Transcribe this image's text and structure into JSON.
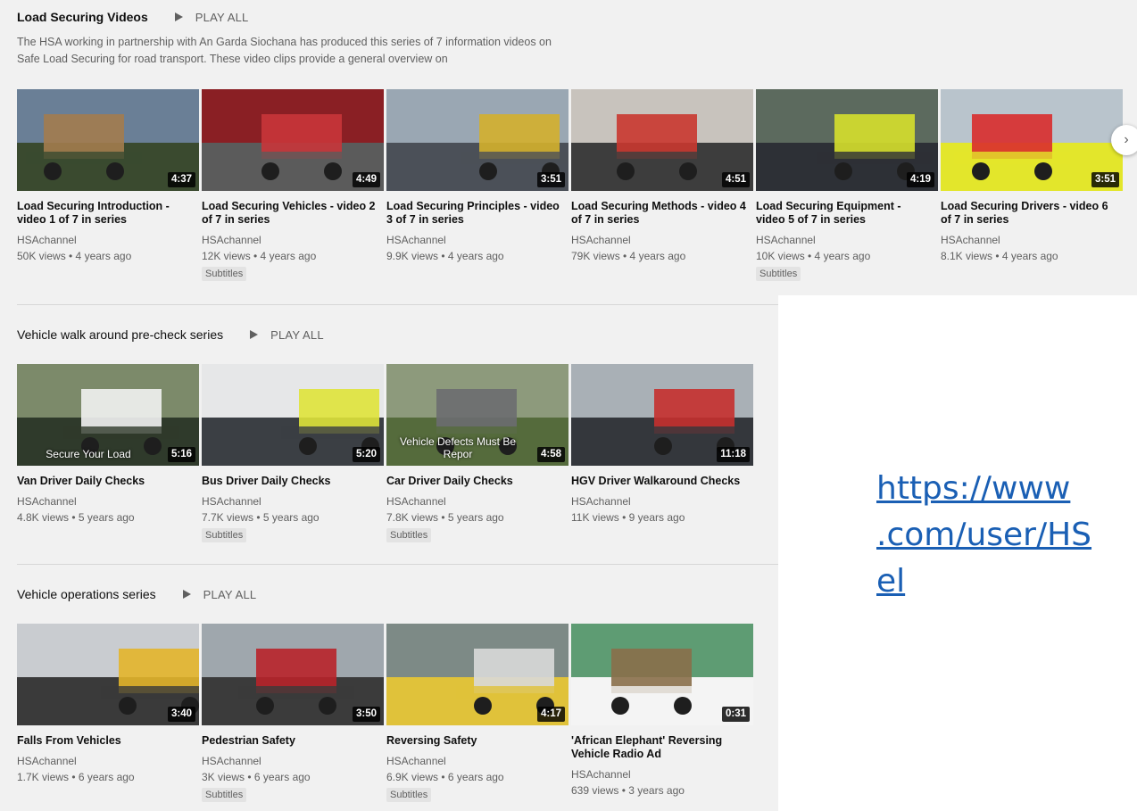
{
  "sections": [
    {
      "title": "Load Securing Videos",
      "play_all": "PLAY ALL",
      "description": "The HSA working in partnership with An Garda Siochana has produced this series of 7 information videos on Safe Load Securing for road transport. These video clips provide a general overview on",
      "videos": [
        {
          "title": "Load Securing Introduction - video 1 of 7 in series",
          "channel": "HSAchannel",
          "meta": "50K views • 4 years ago",
          "duration": "4:37",
          "badge": "",
          "thumb_colors": [
            "#6a7f96",
            "#a37c4e",
            "#3a4a2f"
          ]
        },
        {
          "title": "Load Securing Vehicles - video 2 of 7 in series",
          "channel": "HSAchannel",
          "meta": "12K views • 4 years ago",
          "duration": "4:49",
          "badge": "Subtitles",
          "thumb_colors": [
            "#8a1f24",
            "#c8353a",
            "#5b5b5b"
          ]
        },
        {
          "title": "Load Securing Principles - video 3 of 7 in series",
          "channel": "HSAchannel",
          "meta": "9.9K views • 4 years ago",
          "duration": "3:51",
          "badge": "",
          "thumb_colors": [
            "#9aa7b3",
            "#d4b02c",
            "#4b5058"
          ]
        },
        {
          "title": "Load Securing Methods - video 4 of 7 in series",
          "channel": "HSAchannel",
          "meta": "79K views • 4 years ago",
          "duration": "4:51",
          "badge": "",
          "thumb_colors": [
            "#c8c3bd",
            "#c9372f",
            "#3d3d3d"
          ]
        },
        {
          "title": "Load Securing Equipment - video 5 of 7 in series",
          "channel": "HSAchannel",
          "meta": "10K views • 4 years ago",
          "duration": "4:19",
          "badge": "Subtitles",
          "thumb_colors": [
            "#5c6a5e",
            "#d6e02c",
            "#2d3036"
          ]
        },
        {
          "title": "Load Securing Drivers - video 6 of 7 in series",
          "channel": "HSAchannel",
          "meta": "8.1K views • 4 years ago",
          "duration": "3:51",
          "badge": "",
          "thumb_colors": [
            "#b9c4cc",
            "#d92c2c",
            "#e3e62b"
          ]
        }
      ]
    },
    {
      "title": "Vehicle walk around pre-check series",
      "play_all": "PLAY ALL",
      "description": "",
      "videos": [
        {
          "title": "Van Driver Daily Checks",
          "channel": "HSAchannel",
          "meta": "4.8K views • 5 years ago",
          "duration": "5:16",
          "badge": "",
          "overlay": "Secure Your Load",
          "thumb_colors": [
            "#7c8a6a",
            "#f2f2f2",
            "#2f3a2b"
          ]
        },
        {
          "title": "Bus Driver Daily Checks",
          "channel": "HSAchannel",
          "meta": "7.7K views • 5 years ago",
          "duration": "5:20",
          "badge": "Subtitles",
          "overlay": "",
          "thumb_colors": [
            "#e6e7e8",
            "#dfe33a",
            "#3b3f44"
          ]
        },
        {
          "title": "Car Driver Daily Checks",
          "channel": "HSAchannel",
          "meta": "7.8K views • 5 years ago",
          "duration": "4:58",
          "badge": "Subtitles",
          "overlay": "Vehicle Defects Must Be Repor",
          "thumb_colors": [
            "#8d9a7c",
            "#6b6d70",
            "#556b3c"
          ]
        },
        {
          "title": "HGV Driver Walkaround Checks",
          "channel": "HSAchannel",
          "meta": "11K views • 9 years ago",
          "duration": "11:18",
          "badge": "",
          "overlay": "",
          "thumb_colors": [
            "#a9b0b6",
            "#c5302d",
            "#34373c"
          ]
        }
      ]
    },
    {
      "title": "Vehicle operations series",
      "play_all": "PLAY ALL",
      "description": "",
      "videos": [
        {
          "title": "Falls From Vehicles",
          "channel": "HSAchannel",
          "meta": "1.7K views • 6 years ago",
          "duration": "3:40",
          "badge": "",
          "overlay": "",
          "thumb_colors": [
            "#c9ccd0",
            "#e3b52a",
            "#3a3a3a"
          ]
        },
        {
          "title": "Pedestrian Safety",
          "channel": "HSAchannel",
          "meta": "3K views • 6 years ago",
          "duration": "3:50",
          "badge": "Subtitles",
          "overlay": "",
          "thumb_colors": [
            "#9fa7ad",
            "#b8242a",
            "#3b3b3b"
          ]
        },
        {
          "title": "Reversing Safety",
          "channel": "HSAchannel",
          "meta": "6.9K views • 6 years ago",
          "duration": "4:17",
          "badge": "Subtitles",
          "overlay": "",
          "thumb_colors": [
            "#7d8a86",
            "#d9d9d9",
            "#e0c23a"
          ]
        },
        {
          "title": "'African Elephant' Reversing Vehicle Radio Ad",
          "channel": "HSAchannel",
          "meta": "639 views • 3 years ago",
          "duration": "0:31",
          "badge": "",
          "overlay": "",
          "thumb_colors": [
            "#5e9c73",
            "#8a6f4a",
            "#f4f4f4"
          ]
        }
      ]
    }
  ],
  "next_button": "›",
  "link": {
    "lines": [
      "https://www",
      ".com/user/HS",
      "el"
    ]
  }
}
